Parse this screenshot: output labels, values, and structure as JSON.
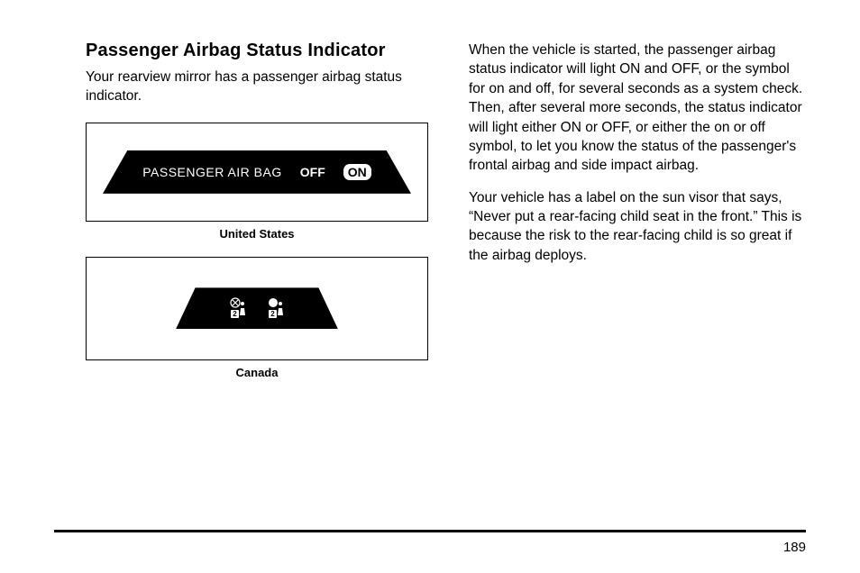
{
  "heading": "Passenger Airbag Status Indicator",
  "intro": "Your rearview mirror has a passenger airbag status indicator.",
  "figure_us": {
    "label": "PASSENGER AIR BAG",
    "off": "OFF",
    "on": "ON",
    "caption": "United States"
  },
  "figure_ca": {
    "caption": "Canada"
  },
  "right_para_1": "When the vehicle is started, the passenger airbag status indicator will light ON and OFF, or the symbol for on and off, for several seconds as a system check. Then, after several more seconds, the status indicator will light either ON or OFF, or either the on or off symbol, to let you know the status of the passenger's frontal airbag and side impact airbag.",
  "right_para_2": "Your vehicle has a label on the sun visor that says, “Never put a rear-facing child seat in the front.” This is because the risk to the rear-facing child is so great if the airbag deploys.",
  "page_number": "189"
}
